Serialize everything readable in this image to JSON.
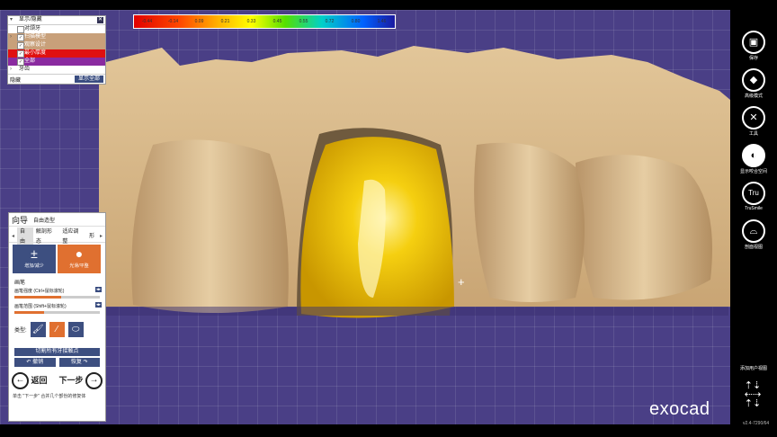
{
  "colors": {
    "viewport_bg": "#4a3f86",
    "gum": "#d8b98a",
    "crown": "#f0c000",
    "accent": "#e07030",
    "panel_button": "#3d4f80"
  },
  "scale_labels": [
    "-0.44",
    "-0.14",
    "0.09",
    "0.21",
    "0.33",
    "0.45",
    "0.55",
    "0.72",
    "0.80",
    "1.46"
  ],
  "layers": {
    "header": "显示/隐藏",
    "items": [
      {
        "label": "对颌牙",
        "checked": false,
        "color": "#ffffff"
      },
      {
        "label": "扫描模型",
        "checked": true,
        "color": "#c8a07a"
      },
      {
        "label": "观察设计",
        "checked": true,
        "color": "#c8a07a"
      },
      {
        "label": "最小厚度",
        "checked": true,
        "color": "#e01010"
      },
      {
        "label": "全部",
        "checked": true,
        "color": "#8a2aa0"
      }
    ],
    "group": "牙齿",
    "footer_left": "隐藏",
    "footer_right": "显示全部"
  },
  "wizard": {
    "title": "向导",
    "subtitle": "自由造型",
    "tabs": [
      "自由",
      "解剖形态",
      "适应调整",
      "形"
    ],
    "tools": [
      {
        "label": "增加/减少",
        "icon": "plus-minus-icon",
        "glyph": "±"
      },
      {
        "label": "光滑/平整",
        "icon": "drop-icon",
        "glyph": "💧"
      }
    ],
    "section": "画笔",
    "sliders": [
      {
        "label": "画笔强度 (Ctrl+鼠标滚轮)",
        "value": 0.55
      },
      {
        "label": "画笔范围 (Shift+鼠标滚轮)",
        "value": 0.35
      }
    ],
    "type_label": "类型:",
    "types": [
      {
        "icon": "brush-icon",
        "glyph": "🖌"
      },
      {
        "icon": "knife-icon",
        "glyph": "∕"
      },
      {
        "icon": "cylinder-icon",
        "glyph": "⬭"
      }
    ],
    "cut_button": "切割所有牙接触点",
    "undo": "撤销",
    "redo": "恢复",
    "back": "返回",
    "next": "下一步",
    "hint": "单击 \"下一步\" 合并几个部份的修复体"
  },
  "sidebar": [
    {
      "label": "保存",
      "icon": "save-icon",
      "glyph": "🖫"
    },
    {
      "label": "高级模式",
      "icon": "graduation-cap-icon",
      "glyph": "🎓"
    },
    {
      "label": "工具",
      "icon": "tools-icon",
      "glyph": "✂"
    },
    {
      "label": "显示咬合空间",
      "icon": "occlusion-icon",
      "glyph": "◐"
    },
    {
      "label": "TruSmile",
      "icon": "trusmile-icon",
      "glyph": "Tru"
    },
    {
      "label": "剖面视图",
      "icon": "section-view-icon",
      "glyph": "⌓"
    }
  ],
  "add_view": "添加用户视图",
  "brand": "exocad",
  "version": "v2.4-7290/64"
}
